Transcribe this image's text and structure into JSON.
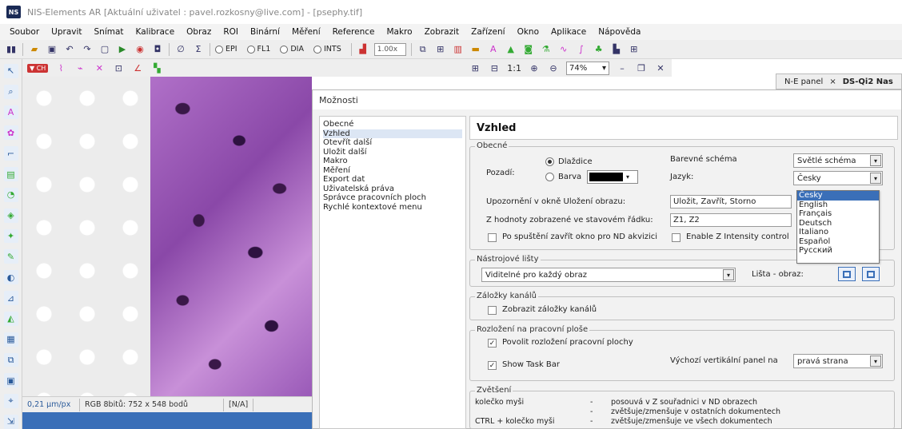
{
  "window": {
    "title": "NIS-Elements AR [Aktuální uživatel : pavel.rozkosny@live.com] - [psephy.tif]",
    "logo": "NS"
  },
  "menu": [
    "Soubor",
    "Upravit",
    "Snímat",
    "Kalibrace",
    "Obraz",
    "ROI",
    "Binární",
    "Měření",
    "Reference",
    "Makro",
    "Zobrazit",
    "Zařízení",
    "Okno",
    "Aplikace",
    "Nápověda"
  ],
  "toolbar": {
    "radios": [
      "EPI",
      "FL1",
      "DIA",
      "INTS"
    ],
    "objective_zoom": "1.00x",
    "ratio_label": "1:1",
    "zoom_value": "74%"
  },
  "right_panel": {
    "tab1": "N-E panel",
    "tab1_close": "×",
    "tab2": "DS-Qi2 Nas"
  },
  "status": {
    "scale": "0,21 µm/px",
    "info": "RGB 8bitů: 752 x 548 bodů",
    "na": "[N/A]"
  },
  "dialog": {
    "title": "Možnosti",
    "nav_items": [
      "Obecné",
      "Vzhled",
      "Otevřít další",
      "Uložit další",
      "Makro",
      "Měření",
      "Export dat",
      "Uživatelská práva",
      "Správce pracovních ploch",
      "Rychlé kontextové menu"
    ],
    "selected_nav": 1,
    "heading": "Vzhled",
    "general": {
      "legend": "Obecné",
      "background_label": "Pozadí:",
      "radio_tiles": "Dlaždice",
      "radio_color": "Barva",
      "scheme_label": "Barevné schéma",
      "scheme_value": "Světlé schéma",
      "language_label": "Jazyk:",
      "language_value": "Česky",
      "language_options": [
        "Česky",
        "English",
        "Français",
        "Deutsch",
        "Italiano",
        "Español",
        "Русский"
      ],
      "save_warning_label": "Upozornění v okně Uložení obrazu:",
      "save_warning_value": "Uložit, Zavřít, Storno",
      "statusbar_values_label": "Z hodnoty zobrazené ve stavovém řádku:",
      "statusbar_values_value": "Z1, Z2",
      "close_nd_label": "Po spuštění zavřít okno pro ND akvizici",
      "z_intensity_label": "Enable Z Intensity control"
    },
    "toolbars": {
      "legend": "Nástrojové lišty",
      "mode_value": "Viditelné pro každý obraz",
      "image_bar_label": "Lišta - obraz:"
    },
    "channel_tabs": {
      "legend": "Záložky kanálů",
      "show_label": "Zobrazit záložky kanálů"
    },
    "layout": {
      "legend": "Rozložení na pracovní ploše",
      "allow_label": "Povolit rozložení pracovní plochy",
      "taskbar_label": "Show Task Bar",
      "default_panel_label": "Výchozí vertikální panel na",
      "default_panel_value": "pravá strana"
    },
    "zoom": {
      "legend": "Zvětšení",
      "rows": [
        {
          "key": "kolečko myši",
          "dash": "-",
          "text": "posouvá v Z souřadnici v ND obrazech"
        },
        {
          "key": "",
          "dash": "-",
          "text": "zvětšuje/zmenšuje v ostatních dokumentech"
        },
        {
          "key": "CTRL + kolečko myši",
          "dash": "-",
          "text": "zvětšuje/zmenšuje ve všech dokumentech"
        }
      ]
    }
  },
  "colors": {
    "accent": "#3a6fb8",
    "selection": "#dce6f4",
    "image_purple": "#9a5ab8"
  }
}
